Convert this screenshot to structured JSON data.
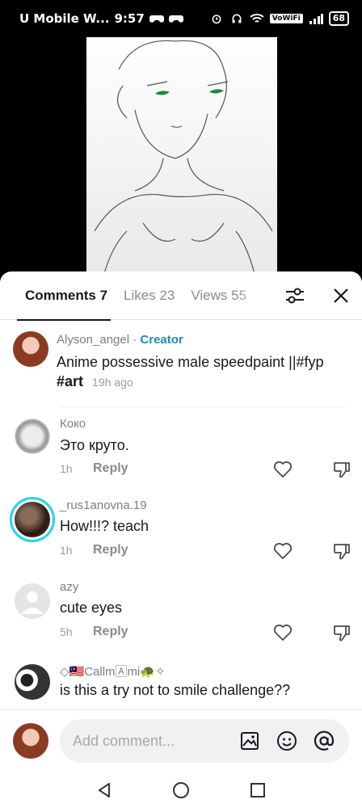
{
  "status_bar": {
    "carrier": "U Mobile W...",
    "time": "9:57",
    "volte": "VoWiFi",
    "battery": "68"
  },
  "tabs": [
    {
      "label": "Comments 7",
      "active": true
    },
    {
      "label": "Likes 23",
      "active": false
    },
    {
      "label": "Views 55",
      "active": false
    }
  ],
  "comments": [
    {
      "username": "Alyson_angel",
      "separator": "·",
      "badge": "Creator",
      "text_line1": "Anime possessive male speedpaint ||#fyp",
      "text_line2": "#art",
      "time": "19h ago"
    },
    {
      "username": "Коко",
      "text": "Это круто.",
      "time": "1h",
      "reply": "Reply"
    },
    {
      "username": "_rus1anovna.19",
      "text": "How!!!? teach",
      "time": "1h",
      "reply": "Reply"
    },
    {
      "username": "azy",
      "text": "cute eyes",
      "time": "5h",
      "reply": "Reply"
    },
    {
      "username": "◇🇲🇾Callm🄰mi🐢✧",
      "text": "is this a try not to smile challenge??"
    }
  ],
  "composer": {
    "placeholder": "Add comment..."
  },
  "icons": {
    "accent": "#1f8fa5",
    "story_ring": "#20d5ec"
  }
}
